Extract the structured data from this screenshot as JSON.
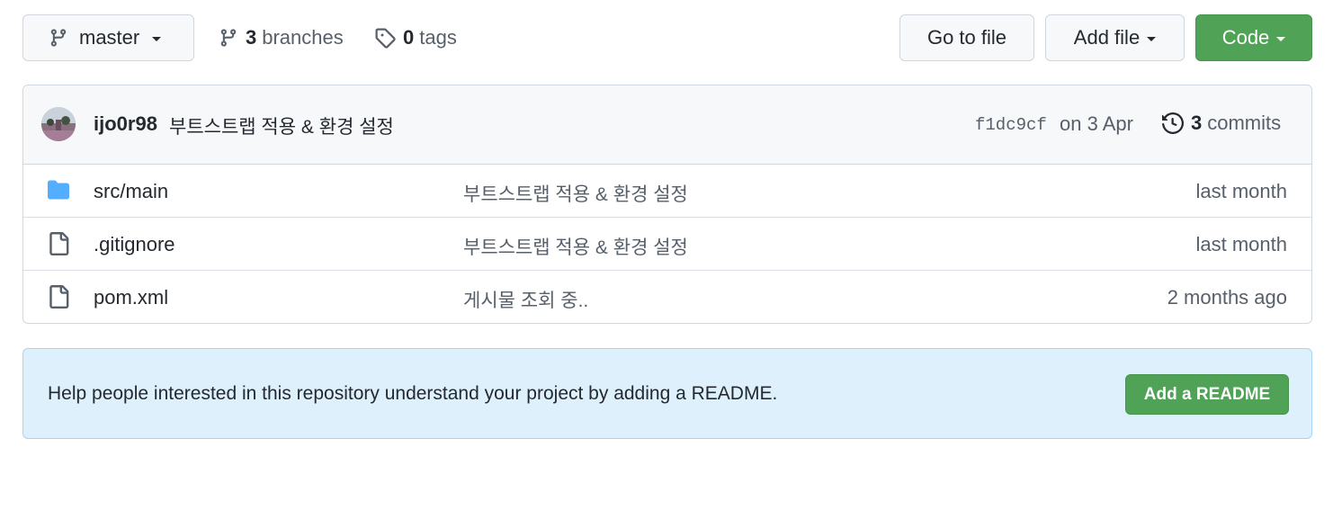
{
  "toolbar": {
    "branch_label": "master",
    "branches_count": "3",
    "branches_label": "branches",
    "tags_count": "0",
    "tags_label": "tags",
    "goto_file_label": "Go to file",
    "add_file_label": "Add file",
    "code_label": "Code"
  },
  "commit": {
    "author": "ijo0r98",
    "message": "부트스트랩 적용 & 환경 설정",
    "sha": "f1dc9cf",
    "date": "on 3 Apr",
    "commits_count": "3",
    "commits_label": "commits"
  },
  "files": [
    {
      "name": "src/main",
      "type": "folder",
      "message": "부트스트랩 적용 & 환경 설정",
      "age": "last month"
    },
    {
      "name": ".gitignore",
      "type": "file",
      "message": "부트스트랩 적용 & 환경 설정",
      "age": "last month"
    },
    {
      "name": "pom.xml",
      "type": "file",
      "message": "게시물 조회 중..",
      "age": "2 months ago"
    }
  ],
  "readme": {
    "text": "Help people interested in this repository understand your project by adding a README.",
    "button_label": "Add a README"
  },
  "colors": {
    "primary_button": "#4fa256",
    "folder_icon": "#54aeff",
    "readme_background": "#ddf0fc"
  }
}
